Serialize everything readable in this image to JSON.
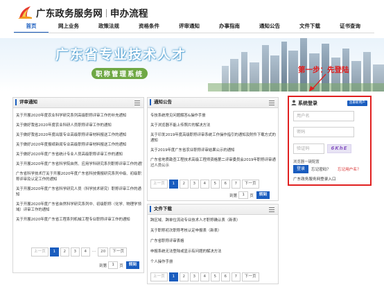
{
  "header": {
    "brand": "广东政务服务网",
    "subtitle": "申办流程"
  },
  "nav": [
    "首页",
    "网上业务",
    "政策法规",
    "资格条件",
    "评审通知",
    "办事指南",
    "通知公告",
    "文件下载",
    "证书查询"
  ],
  "banner": {
    "title": "广东省专业技术人才",
    "subtitle": "职称管理系统",
    "step_note": "第一步：先登陆"
  },
  "review_notice": {
    "title": "评审通知",
    "items": [
      "关于开展2020年度农业科学研究系列高级职称评审工作的补充通知",
      "关于做好我省2020年度农业科研人员职称评审工作的通知",
      "关于做好我省2020年度出版专业高级职称评审材料报送工作的通知",
      "关于做好2020年度报纸新闻专业高级职称评审材料报送工作的通知",
      "关于做好2020年度广东省统计专业人员高级职称评审工作的通知",
      "关于开展2020年度广东省科学院自然、应用学科研究系列职称评审工作的通知",
      "广东省科学技术厅关于开展2020年度广东省科技情报研究系列中级、初级职称评审及认定工作的通知",
      "关于开展2020年度广东省科学研究人员（科学技术研究）职称评审工作的通知",
      "关于开展2020年度广东省自然科学研究系列中、初级职称（化学、物理学领域）评审工作的通知",
      "关于开展2020年度广东省工程系列机械工程专业职称评审工作的通知"
    ],
    "pager": {
      "first": "上一页",
      "pages": [
        "1",
        "2",
        "3",
        "4",
        "...",
        "20"
      ],
      "next": "下一页",
      "goto_prefix": "到第",
      "goto_value": "1",
      "goto_suffix": "页",
      "goto_button": "转到"
    }
  },
  "notices": {
    "title": "通知公告",
    "items": [
      "专技系统常见问题解答&操作手册",
      "关于浏览器不能上传照片的解决方法",
      "关于印发2019年度高级职称评审系统工作操作指引的通知及附件下载方式的通知",
      "关于2019年度广东省农业职称评审结果公示的通知",
      "广东省地质勘查工程技术高级工程师资格第二评审委员会2019年职称评审通过人员公示"
    ],
    "pager": {
      "first": "上一页",
      "pages": [
        "1",
        "2",
        "3",
        "4",
        "5",
        "6",
        "7"
      ],
      "next": "下一页",
      "goto_prefix": "到第",
      "goto_value": "1",
      "goto_suffix": "页",
      "goto_button": "转到"
    }
  },
  "downloads": {
    "title": "文件下载",
    "items": [
      "跨区域、跨单位流动专业技术人才职称确认表（新表）",
      "关于职称初次职称考核认定申报表（新表）",
      "广东省职称评审表格",
      "申报系统无法登陆或显示有问题的解决方法",
      "个人操作手册"
    ],
    "pager": {
      "first": "上一页",
      "pages": [
        "1",
        "2",
        "3",
        "4",
        "5",
        "6",
        "7"
      ],
      "next": "下一页",
      "goto_prefix": "到第",
      "goto_value": "1",
      "goto_suffix": "页",
      "goto_button": "转到"
    }
  },
  "login": {
    "title": "系统登录",
    "register": "注册新用户",
    "username_placeholder": "用户名",
    "password_placeholder": "密码",
    "captcha_placeholder": "验证码",
    "captcha_text": "6KhE",
    "browser_note": "浏览器一键配置",
    "login_button": "登录",
    "forgot_password": "忘记密码？",
    "forgot_username": "忘记用户名？",
    "gov_login": "广东政务服务网登录入口"
  },
  "colors": {
    "primary": "#1a5dbf",
    "highlight": "#e02020"
  }
}
